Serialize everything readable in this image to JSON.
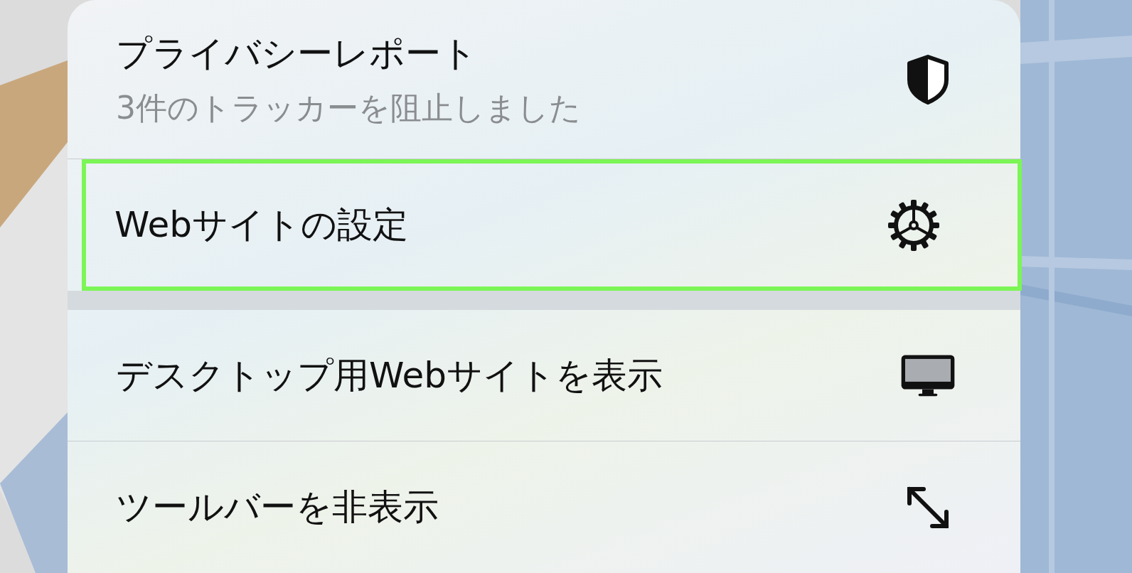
{
  "menu": {
    "items": [
      {
        "kind": "shield",
        "title": "プライバシーレポート",
        "subtitle": "3件のトラッカーを阻止しました",
        "selected": false,
        "section_end": false
      },
      {
        "kind": "gear",
        "title": "Webサイトの設定",
        "selected": true,
        "section_end": true
      },
      {
        "kind": "desktop",
        "title": "デスクトップ用Webサイトを表示",
        "selected": false,
        "section_end": false
      },
      {
        "kind": "expand",
        "title": "ツールバーを非表示",
        "selected": false,
        "section_end": false
      }
    ]
  }
}
